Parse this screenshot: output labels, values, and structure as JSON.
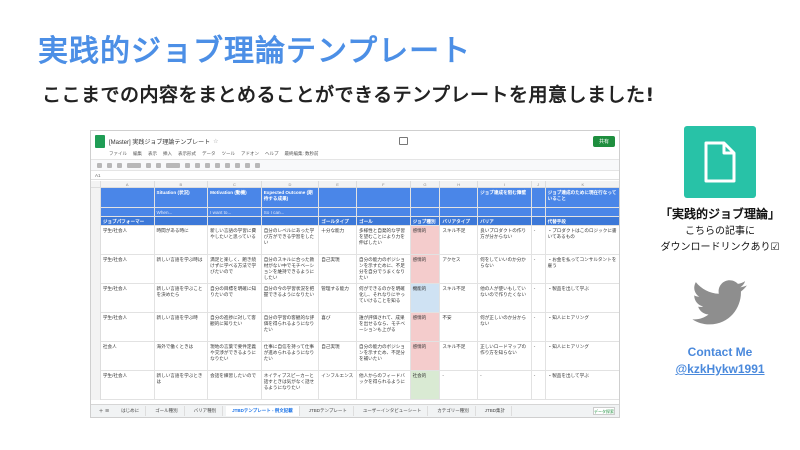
{
  "slide": {
    "title": "実践的ジョブ理論テンプレート",
    "subtitle": "ここまでの内容をまとめることができるテンプレートを用意しました!"
  },
  "sheet": {
    "doc_title": "[Master] 実践ジョブ理論テンプレート",
    "share_label": "共有",
    "menu": [
      "ファイル",
      "編集",
      "表示",
      "挿入",
      "表示形式",
      "データ",
      "ツール",
      "アドオン",
      "ヘルプ",
      "最終編集: 数秒前"
    ],
    "cell_ref": "A1",
    "columns": [
      "A",
      "B",
      "C",
      "D",
      "E",
      "F",
      "G",
      "H",
      "I",
      "J",
      "K"
    ],
    "header_row_1": [
      "",
      "Situation (状況)",
      "Motivation (動機)",
      "Expected Outcome (期待する成果)",
      "",
      "",
      "",
      "",
      "ジョブ達成を阻む障壁",
      "",
      "ジョブ達成のために現在行なっていること"
    ],
    "header_row_2": [
      "",
      "When...",
      "I want to...",
      "So I can...",
      "",
      "",
      "",
      "",
      "",
      "",
      ""
    ],
    "header_row_3": [
      "ジョブパフォーマー",
      "",
      "",
      "",
      "ゴールタイプ(H)",
      "ゴール",
      "ジョブ種別",
      "バリアタイプ",
      "バリア",
      "",
      "代替手段"
    ],
    "rows": [
      [
        "学生/社会人",
        "時間がある時に",
        "新しい言語の学習に費やしたいと思っている",
        "自分のレベルにあった学び方ができる学習をしたい",
        "十分な能力",
        "多様性と自発的な学習を望むことにより力を伸ばしたい",
        "感情的",
        "スキル不足",
        "良いプロダクトの作り方が分からない",
        "-",
        "・プロダクトはこのロジックに書いてあるもの"
      ],
      [
        "学生/社会人",
        "新しい言語を学ぶ時は",
        "満足と楽しく、飽き続けずに学べる方法で学びたいので",
        "自分のスキルに合った教材がない中でモチベーションを維持できるようにしたい",
        "自己実現",
        "自分の能力のボジションを示すために、不足分を自分でうまくなりたい",
        "感情的",
        "アクセス",
        "何をしていいのか分からない",
        "-",
        "・お金を払ってコンサルタントを雇う"
      ],
      [
        "学生/社会人",
        "新しい言語を学ぶことを決めたら",
        "自分の目標を明確に知りたいので",
        "自分の今の学習状況を把握できるようになりたい",
        "管理する能力",
        "何ができるのかを明確化し、それなりにやっていけることを知る",
        "機能的",
        "スキル不足",
        "他の人が使いもしていないので作りたくない",
        "-",
        "・製品を出して学ぶ"
      ],
      [
        "学生/社会人",
        "新しい言語を学ぶ時",
        "自分の進捗に対して客観的に知りたい",
        "自分の学習の客観的な評価を得られるようになりたい",
        "喜び",
        "誰が評価されて、成果を出せるなら、モチベーションも上がる",
        "感情的",
        "不安",
        "何が正しいのか分からない",
        "-",
        "・知人にヒアリング"
      ],
      [
        "社会人",
        "海外で働くときは",
        "現地の言葉で要件定義や交渉ができるようになりたい",
        "仕事に自信を持って仕事が進められるようになりたい",
        "自己実現",
        "自分の能力のボジションを示すため、不足分を補いたい",
        "感情的",
        "スキル不足",
        "正しいロードマップの作り方を知らない",
        "-",
        "・知人にヒアリング"
      ],
      [
        "学生/社会人",
        "新しい言語を学ぶときは",
        "会話を練習したいので",
        "ネイティブスピーカーと話すときは気がなく話せるようになりたい",
        "インフルエンス",
        "他人からのフィードバックを得られるように",
        "社会的",
        "-",
        "-",
        "-",
        "・製品を出して学ぶ"
      ]
    ],
    "tabs": [
      "はじめに",
      "ゴール種別",
      "バリア種別",
      "JTBDテンプレート - 例文記載",
      "JTBDテンプレート",
      "ユーザーインタビューシート",
      "カテゴリー種別",
      "JTBD集計"
    ],
    "explore_label": "データ探索"
  },
  "article": {
    "title": "「実践的ジョブ理論」",
    "line1": "こちらの記事に",
    "line2": "ダウンロードリンクあり☑"
  },
  "contact": {
    "title": "Contact Me",
    "handle": "@kzkHykw1991"
  },
  "colors": {
    "title_blue": "#4c8fe6",
    "header_blue": "#4a86e8",
    "tile_teal": "#28c2a7",
    "twitter_gray": "#8e8e8e",
    "contact_blue": "#4a89dc"
  }
}
